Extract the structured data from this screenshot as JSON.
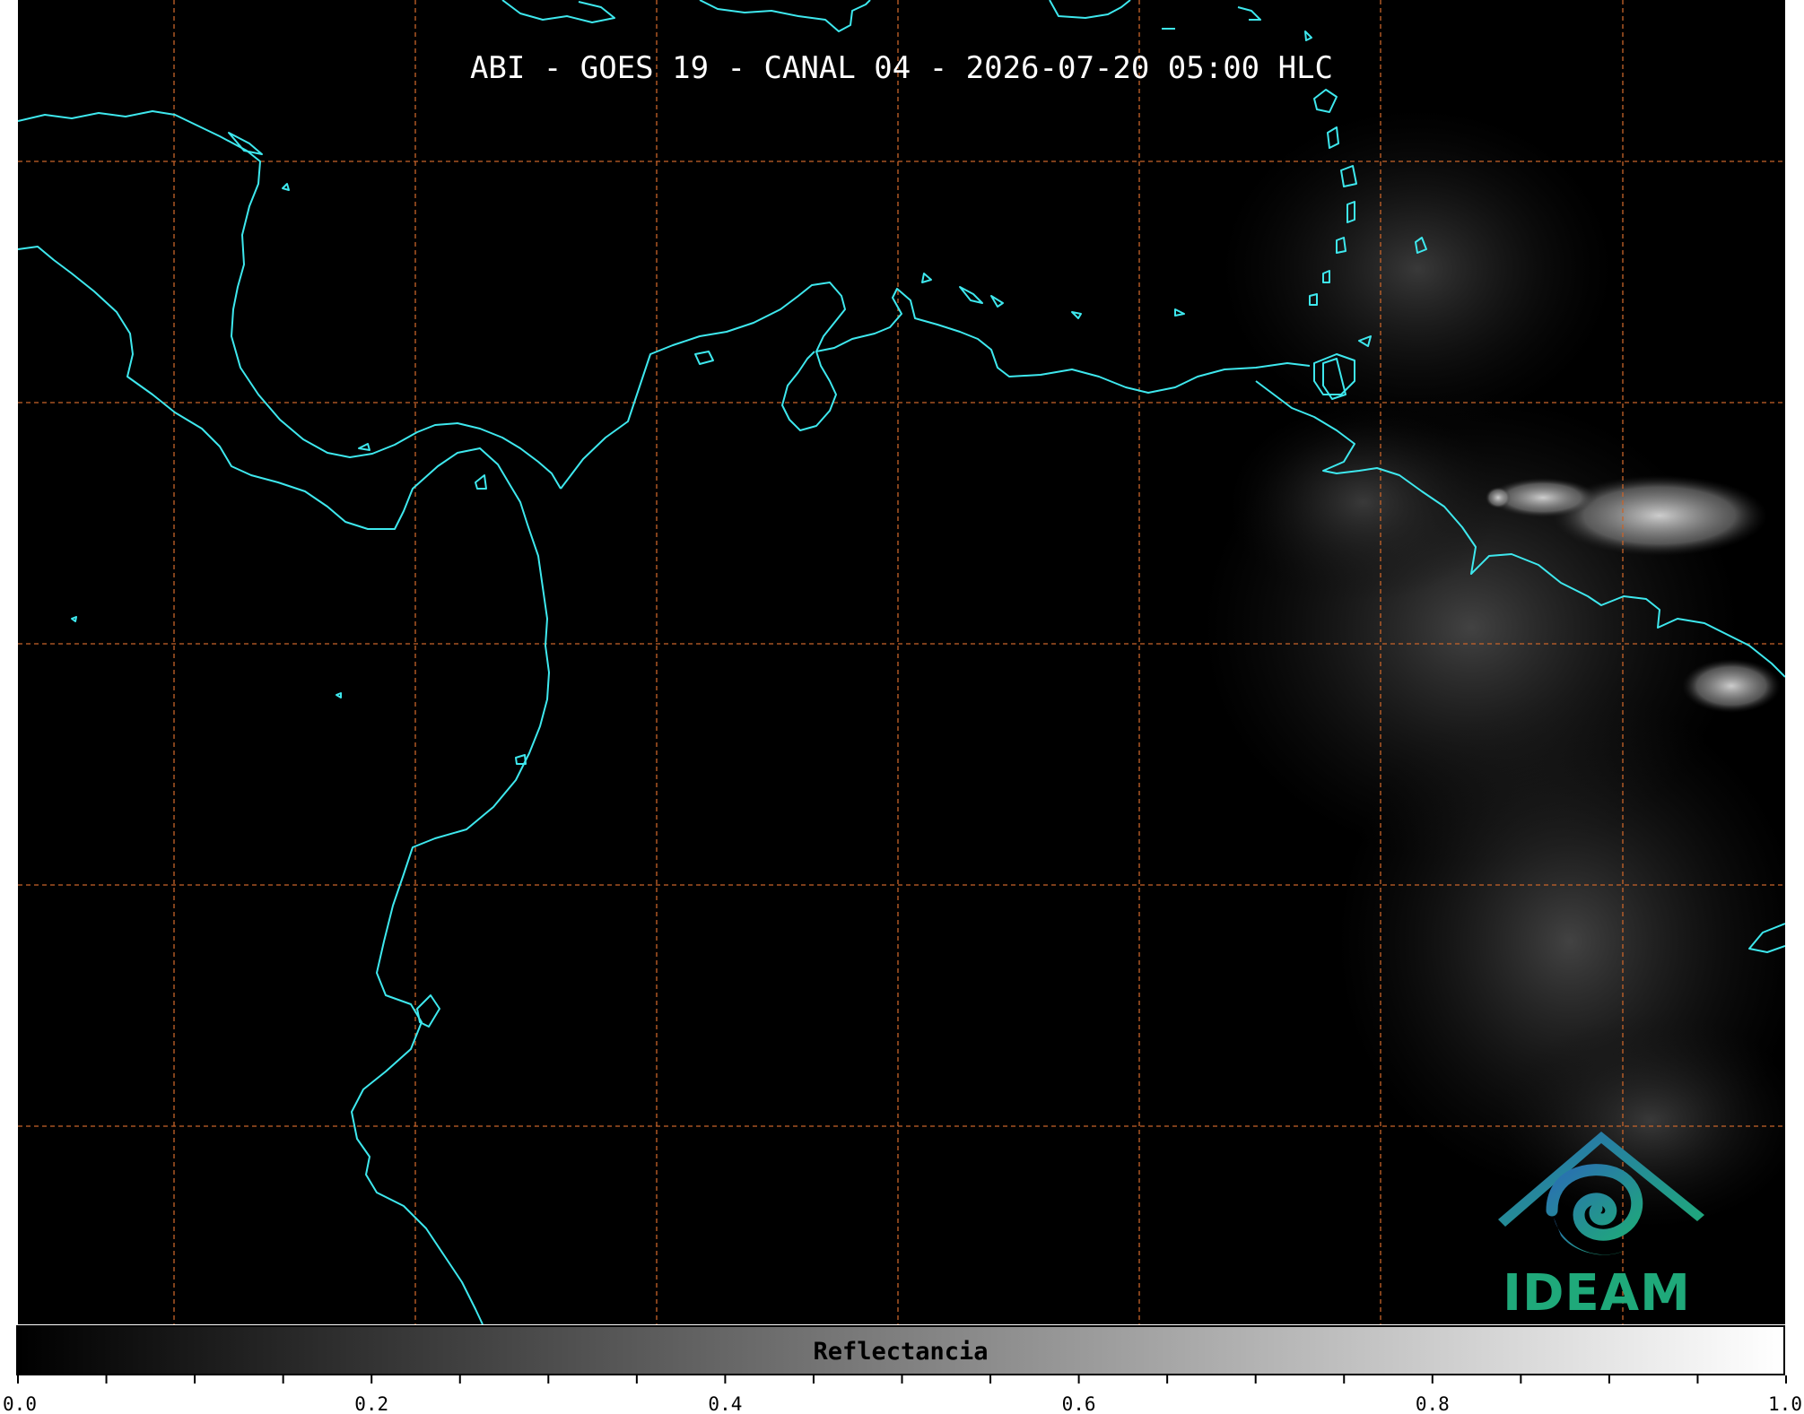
{
  "title": "ABI - GOES 19 - CANAL 04 - 2026-07-20 05:00 HLC",
  "colorbar": {
    "label": "Reflectancia",
    "range": [
      0.0,
      1.0
    ],
    "colormap": "grayscale black-to-white",
    "major_ticks": [
      {
        "value": 0.0,
        "label": "0.0"
      },
      {
        "value": 0.2,
        "label": "0.2"
      },
      {
        "value": 0.4,
        "label": "0.4"
      },
      {
        "value": 0.6,
        "label": "0.6"
      },
      {
        "value": 0.8,
        "label": "0.8"
      },
      {
        "value": 1.0,
        "label": "1.0"
      }
    ],
    "minor_tick_step": 0.05
  },
  "logo": {
    "text": "IDEAM",
    "colors": [
      "#2a6db4",
      "#1fa97a"
    ]
  },
  "colors": {
    "background": "#000000",
    "coastline": "#3ee8ee",
    "gridlines": "#c8642a",
    "title_text": "#ffffff",
    "cloud_bright": "#cfcfcf",
    "cloud_dim": "#3a3a3a"
  },
  "map": {
    "gridlines": "dashed",
    "features": [
      "coastlines",
      "cloud reflectance"
    ]
  }
}
